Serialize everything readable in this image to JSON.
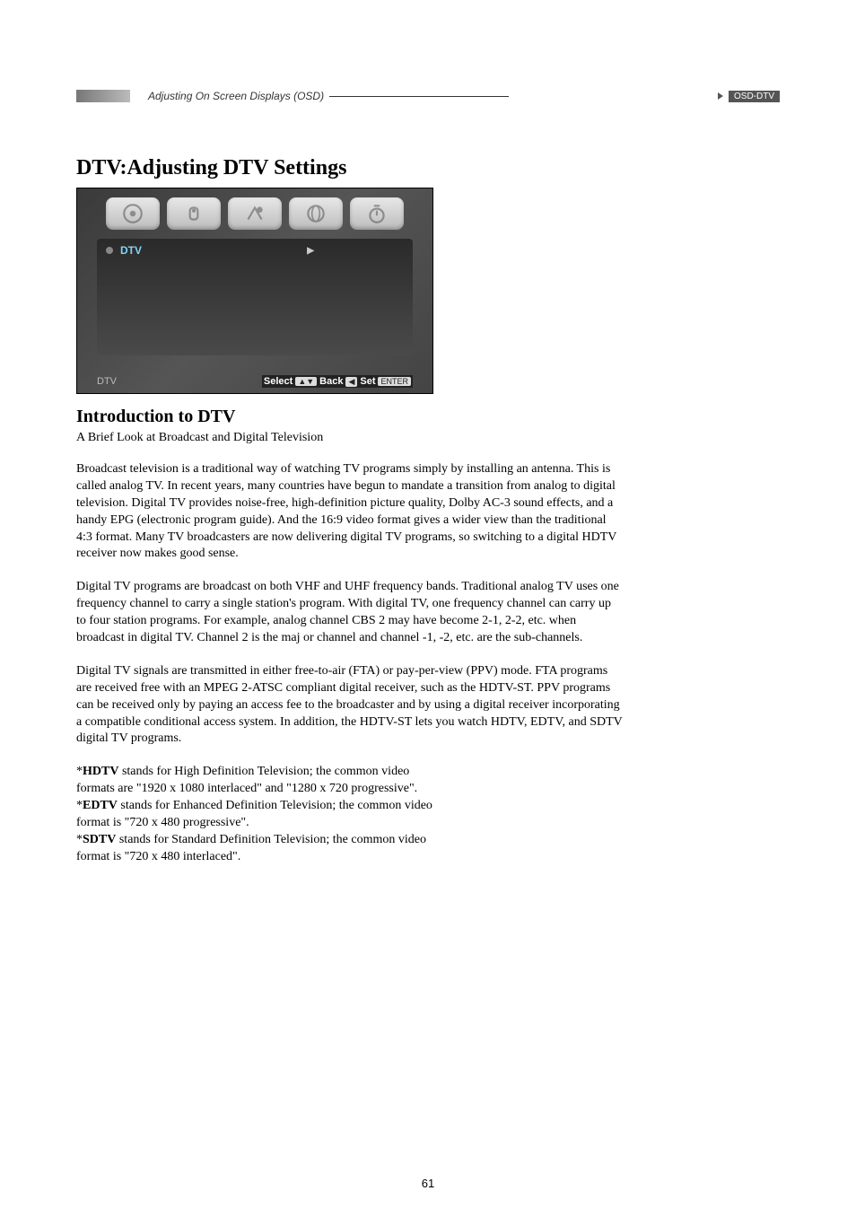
{
  "header": {
    "section_title": "Adjusting On Screen Displays (OSD)",
    "tag": "OSD-DTV"
  },
  "title": "DTV:Adjusting DTV Settings",
  "screenshot": {
    "menu_item": "DTV",
    "footer_tab": "DTV",
    "hint_select": "Select",
    "hint_back": "Back",
    "hint_set": "Set",
    "key_updown": "▲▼",
    "key_left": "◀",
    "key_enter": "ENTER"
  },
  "intro": {
    "heading": "Introduction to DTV",
    "subhead": "A Brief Look at Broadcast and Digital Television",
    "p1": "Broadcast television is a traditional way of watching TV programs simply by installing an antenna. This is called analog TV. In recent years, many countries have begun to mandate a transition from analog to digital television. Digital TV provides noise-free, high-definition picture quality, Dolby AC-3 sound effects, and a handy EPG (electronic program guide). And the 16:9 video format gives a wider view than the traditional 4:3 format. Many TV broadcasters are now delivering digital TV programs, so switching to a digital HDTV receiver now makes good sense.",
    "p2": "Digital TV programs are broadcast on both VHF and UHF frequency bands. Traditional analog TV uses one frequency channel to carry a single station's program. With digital TV, one frequency channel can carry up to four station programs. For example, analog channel CBS 2 may have become 2-1, 2-2, etc. when broadcast in digital TV. Channel 2 is the maj or channel and channel -1, -2, etc. are the sub-channels.",
    "p3": "Digital TV signals are transmitted in either free-to-air (FTA) or pay-per-view (PPV) mode. FTA programs are received free with an MPEG 2-ATSC compliant digital receiver, such as the HDTV-ST. PPV programs can be received only by paying an access fee to the broadcaster and by using a digital receiver incorporating a compatible conditional access system. In addition, the HDTV-ST lets you watch HDTV, EDTV, and SDTV digital TV programs."
  },
  "defs": {
    "hdtv_label": "HDTV",
    "hdtv_text1": " stands for High Definition Television; the common video",
    "hdtv_text2": "formats are \"1920 x 1080 interlaced\" and \"1280 x 720 progressive\".",
    "edtv_label": "EDTV",
    "edtv_text1": " stands for Enhanced Definition Television; the common video",
    "edtv_text2": "format is \"720 x 480 progressive\".",
    "sdtv_label": "SDTV",
    "sdtv_text1": " stands for Standard Definition Television; the common video",
    "sdtv_text2": "format is \"720 x 480 interlaced\"."
  },
  "page_number": "61"
}
